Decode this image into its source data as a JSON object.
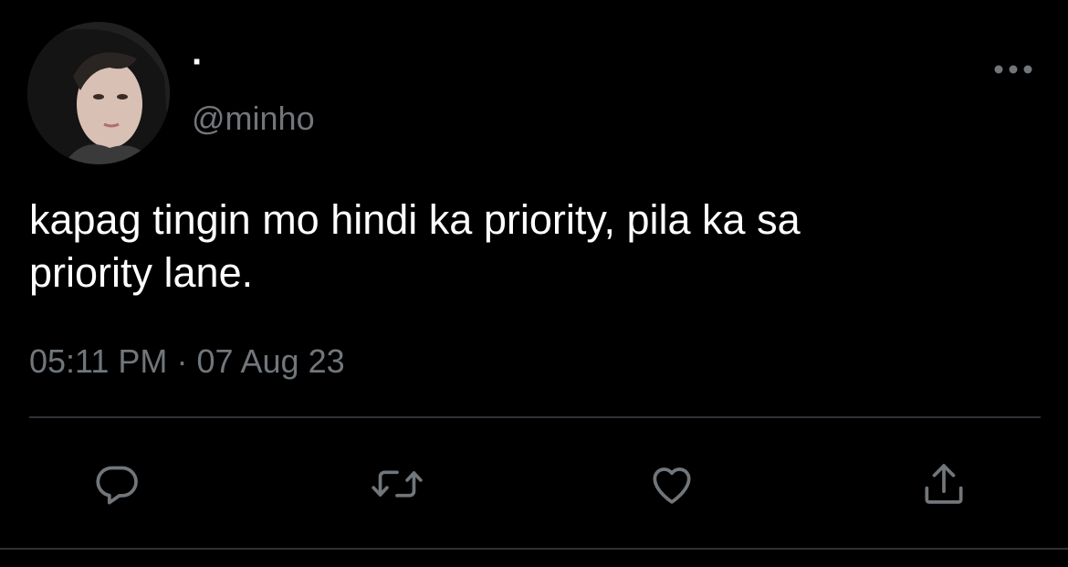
{
  "user": {
    "display_name": "·",
    "handle": "@minho",
    "avatar": "profile-photo"
  },
  "tweet": {
    "text_line1": "kapag tingin mo hindi ka priority, pila ka sa",
    "text_line2": "priority lane.",
    "time": "05:11 PM",
    "separator": "·",
    "date": "07 Aug 23"
  },
  "actions": {
    "reply_icon": "reply-icon",
    "retweet_icon": "retweet-icon",
    "like_icon": "heart-icon",
    "share_icon": "share-icon",
    "more_icon": "more-dots-icon"
  },
  "colors": {
    "background": "#000000",
    "text": "#ffffff",
    "muted": "#71767b",
    "divider": "#2f3336"
  }
}
